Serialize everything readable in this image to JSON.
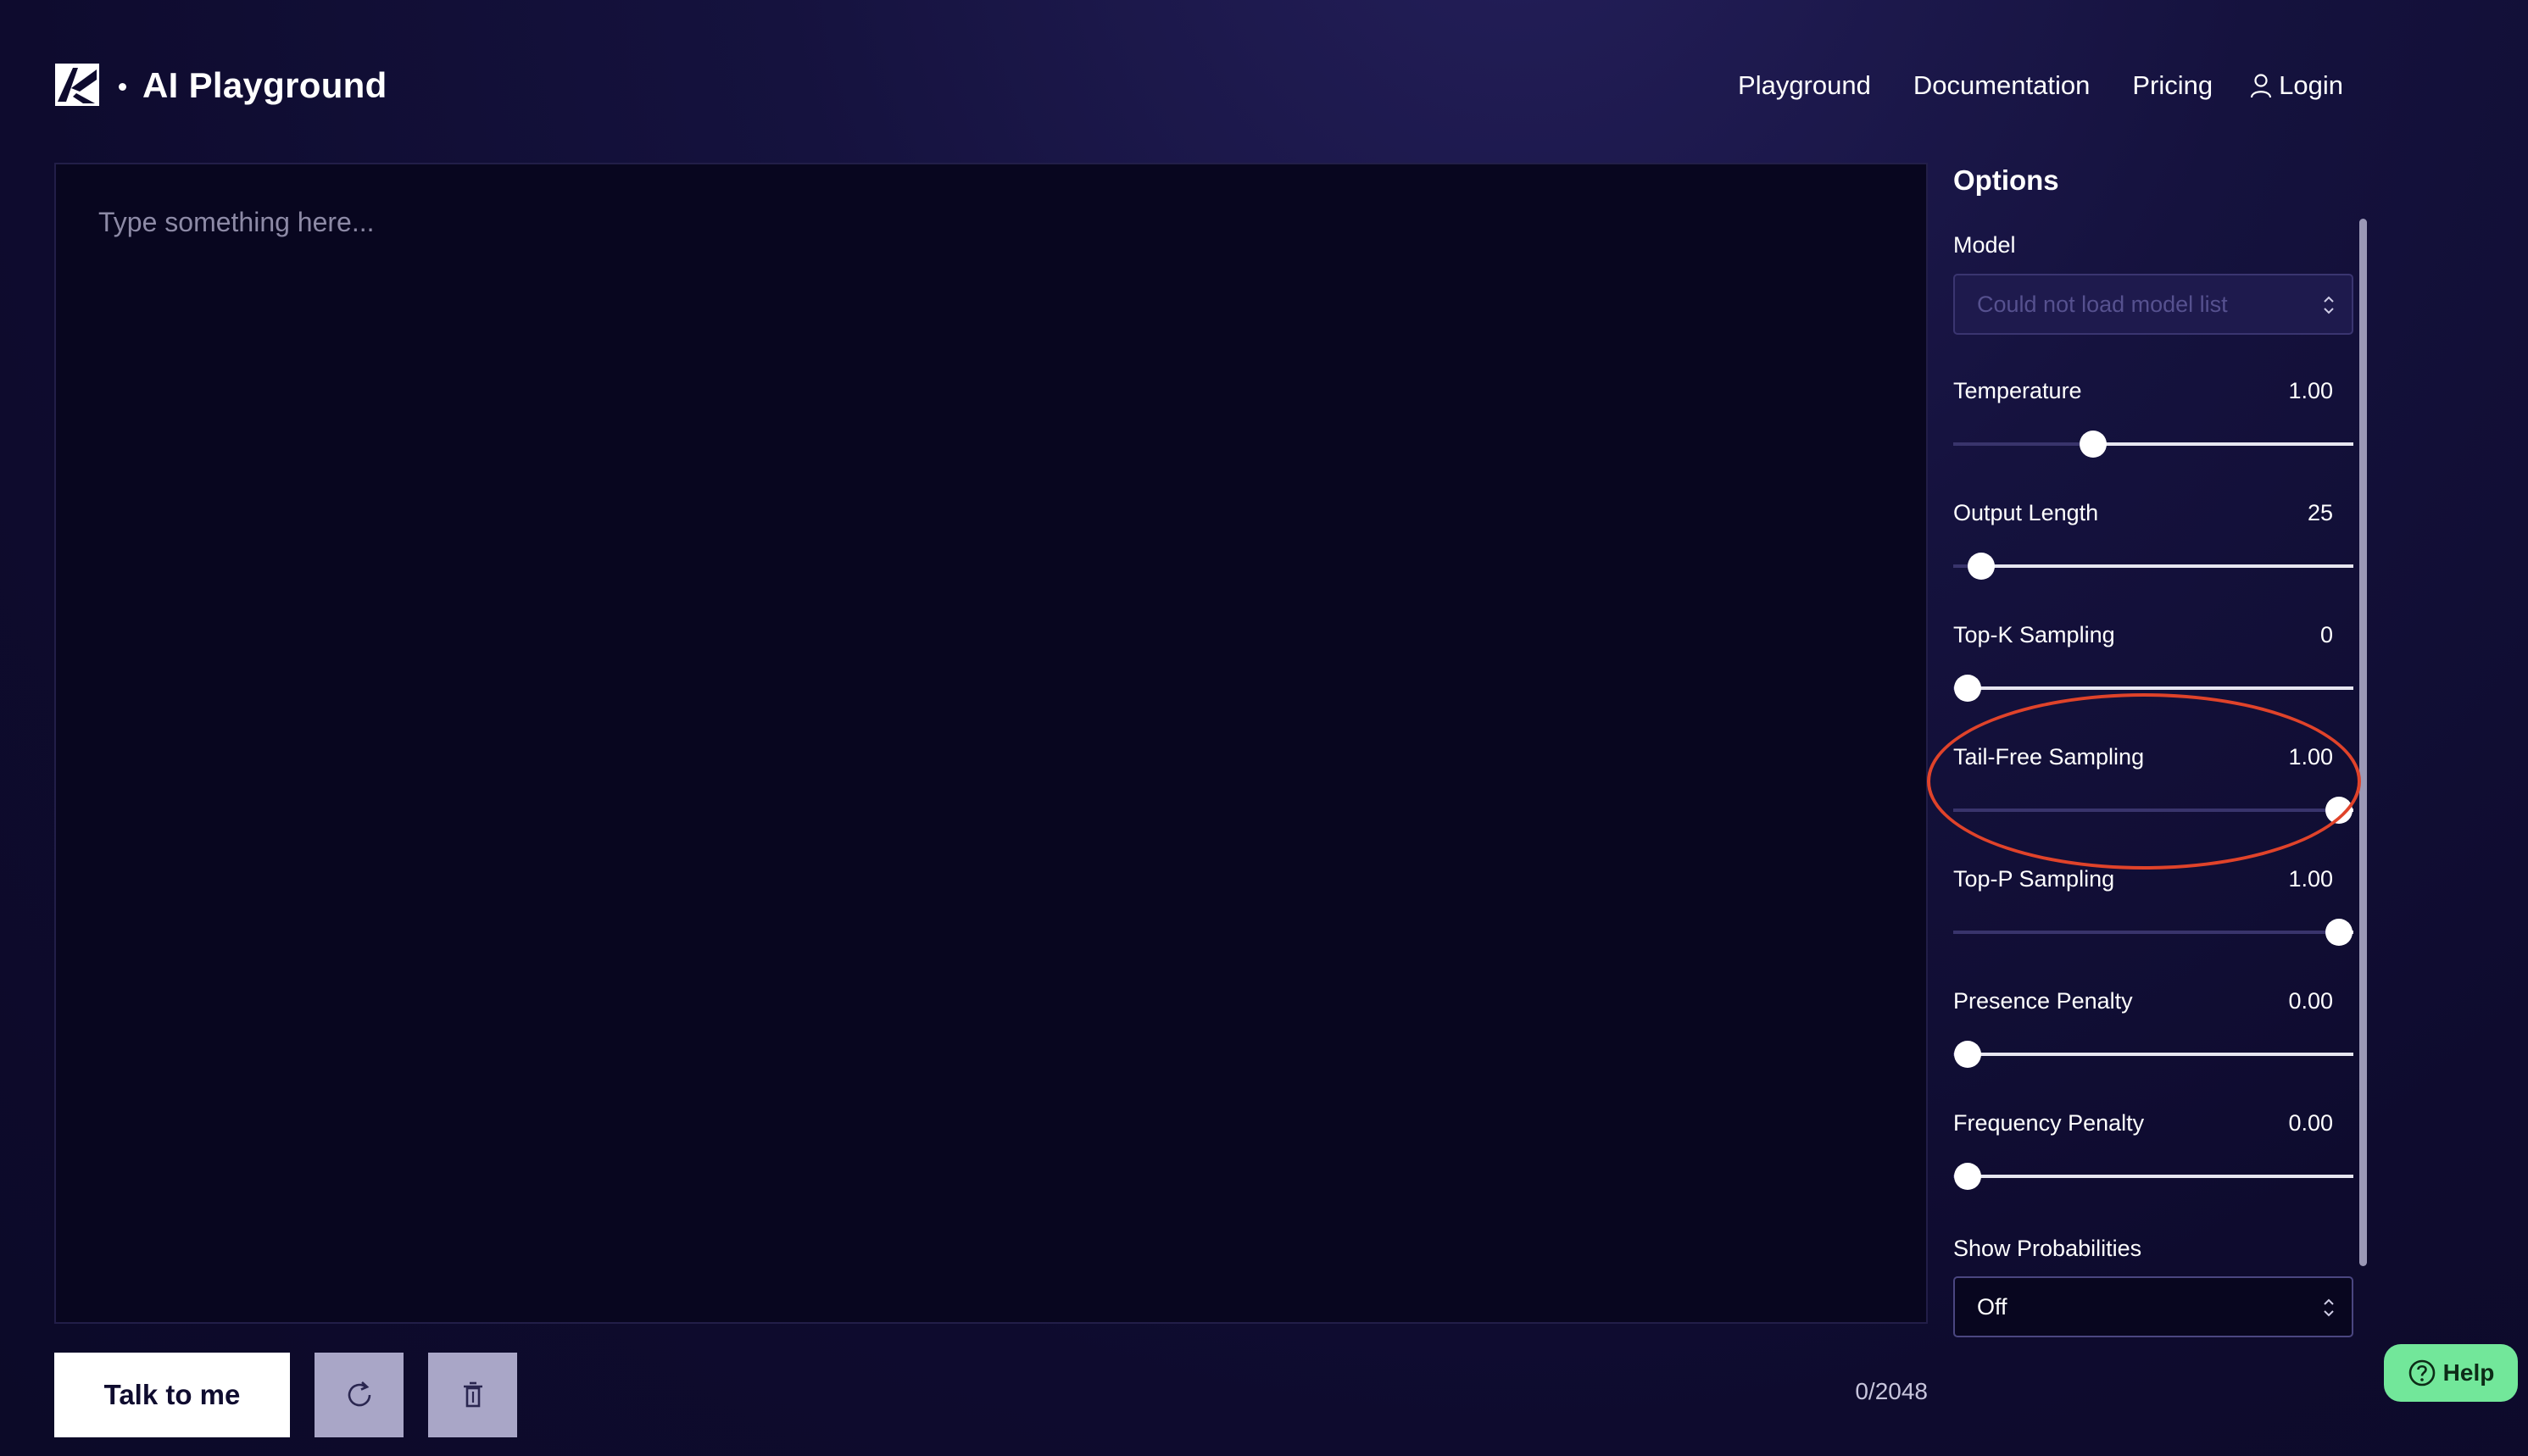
{
  "header": {
    "title": "AI Playground",
    "nav": [
      "Playground",
      "Documentation",
      "Pricing"
    ],
    "login_label": "Login"
  },
  "editor": {
    "placeholder": "Type something here..."
  },
  "actions": {
    "talk_label": "Talk to me",
    "refresh_icon": "refresh-icon",
    "delete_icon": "trash-icon",
    "counter": "0/2048"
  },
  "options": {
    "title": "Options",
    "model": {
      "label": "Model",
      "value": "Could not load model list"
    },
    "sliders": [
      {
        "label": "Temperature",
        "value": "1.00",
        "level": 0.35
      },
      {
        "label": "Output Length",
        "value": "25",
        "level": 0.07
      },
      {
        "label": "Top-K Sampling",
        "value": "0",
        "level": 0.035
      },
      {
        "label": "Tail-Free Sampling",
        "value": "1.00",
        "level": 0.965
      },
      {
        "label": "Top-P Sampling",
        "value": "1.00",
        "level": 0.965
      },
      {
        "label": "Presence Penalty",
        "value": "0.00",
        "level": 0.035
      },
      {
        "label": "Frequency Penalty",
        "value": "0.00",
        "level": 0.035
      }
    ],
    "show_probabilities": {
      "label": "Show Probabilities",
      "value": "Off"
    }
  },
  "help": {
    "label": "Help"
  },
  "colors": {
    "background": "#0e0b2e",
    "accent_help": "#72e79a",
    "annotation": "#e0432a"
  }
}
